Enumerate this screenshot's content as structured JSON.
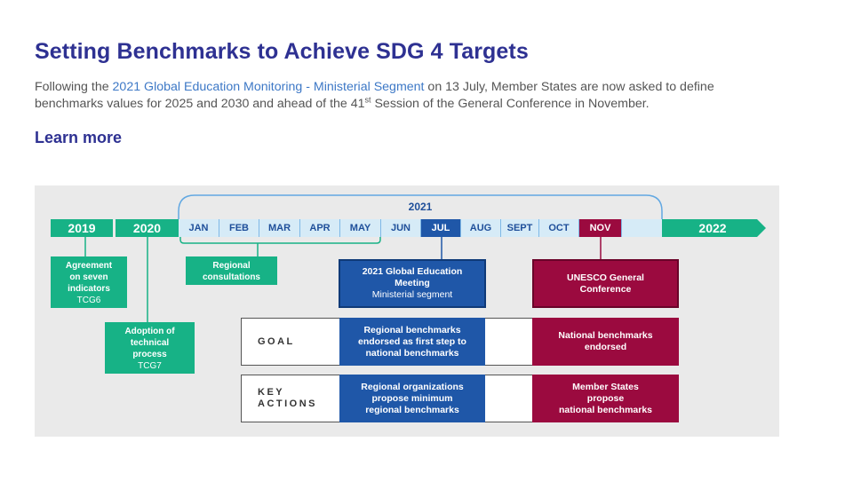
{
  "header": {
    "title": "Setting Benchmarks to Achieve SDG 4 Targets",
    "intro_before_link": "Following the ",
    "intro_link": "2021 Global Education Monitoring - Ministerial Segment",
    "intro_after_link": " on 13 July, Member States are now asked to define benchmarks values for 2025 and 2030 and ahead of the 41",
    "intro_sup": "st",
    "intro_end": " Session of the General Conference in November.",
    "learn_more": "Learn more"
  },
  "timeline": {
    "year_2019": "2019",
    "year_2020": "2020",
    "year_2021": "2021",
    "year_2022": "2022",
    "months": [
      "JAN",
      "FEB",
      "MAR",
      "APR",
      "MAY",
      "JUN",
      "JUL",
      "AUG",
      "SEPT",
      "OCT",
      "NOV"
    ]
  },
  "boxes": {
    "agreement_line1": "Agreement",
    "agreement_line2": "on seven",
    "agreement_line3": "indicators",
    "agreement_sub": "TCG6",
    "adoption_line1": "Adoption of",
    "adoption_line2": "technical",
    "adoption_line3": "process",
    "adoption_sub": "TCG7",
    "regional_line1": "Regional",
    "regional_line2": "consultations",
    "gem_line1": "2021 Global Education",
    "gem_line2": "Meeting",
    "gem_sub": "Ministerial segment",
    "unesco_line1": "UNESCO General",
    "unesco_line2": "Conference"
  },
  "rows": {
    "goal_label": "GOAL",
    "goal_blue_1": "Regional benchmarks",
    "goal_blue_2": "endorsed as first step to",
    "goal_blue_3": "national benchmarks",
    "goal_red_1": "National benchmarks",
    "goal_red_2": "endorsed",
    "key_label_1": "KEY",
    "key_label_2": "ACTIONS",
    "key_blue_1": "Regional organizations",
    "key_blue_2": "propose minimum",
    "key_blue_3": "regional benchmarks",
    "key_red_1": "Member States",
    "key_red_2": "propose",
    "key_red_3": "national benchmarks"
  },
  "colors": {
    "title": "#2e3192",
    "green": "#17b286",
    "blue": "#1f57a8",
    "red": "#9b0a3f",
    "light_blue": "#d6ebf7"
  }
}
